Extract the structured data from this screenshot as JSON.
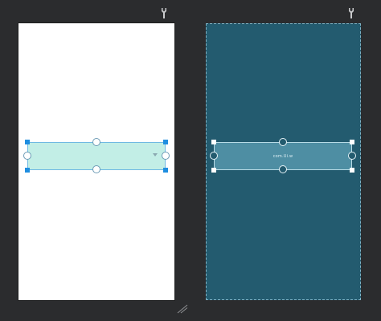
{
  "design_view": {
    "spinner": {
      "text": ""
    }
  },
  "blueprint_view": {
    "spinner": {
      "label": "com.Ui.w"
    }
  },
  "colors": {
    "background": "#2b2c2e",
    "design_surface": "#ffffff",
    "blueprint_surface": "#235b6f",
    "selection_fill": "#c2eee6",
    "selection_accent": "#1f8ee0",
    "blueprint_widget": "#4e8ea3"
  },
  "icons": {
    "pin_left": "wrench-icon",
    "pin_right": "wrench-icon",
    "resize_grip": "resize-grip-icon"
  }
}
